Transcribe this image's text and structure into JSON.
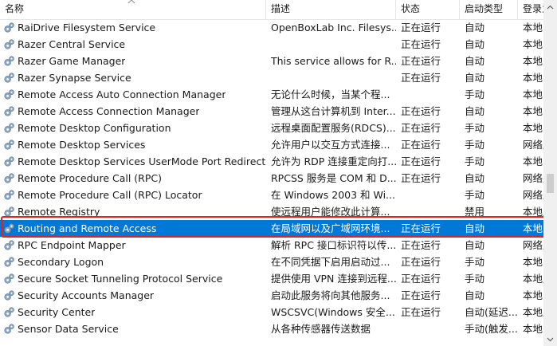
{
  "columns": {
    "name": "名称",
    "desc": "描述",
    "status": "状态",
    "start": "启动类型",
    "logon": "登录为"
  },
  "rows": [
    {
      "name": "RaiDrive Filesystem Service",
      "desc": "OpenBoxLab Inc. Filesys...",
      "status": "正在运行",
      "start": "自动",
      "logon": "本地系统"
    },
    {
      "name": "Razer Central Service",
      "desc": "",
      "status": "正在运行",
      "start": "自动",
      "logon": "本地系统"
    },
    {
      "name": "Razer Game Manager",
      "desc": "This service allows for R...",
      "status": "正在运行",
      "start": "自动",
      "logon": "本地系统"
    },
    {
      "name": "Razer Synapse Service",
      "desc": "",
      "status": "正在运行",
      "start": "自动",
      "logon": "本地系统"
    },
    {
      "name": "Remote Access Auto Connection Manager",
      "desc": "无论什么时候，当某个程...",
      "status": "",
      "start": "手动",
      "logon": "本地系统"
    },
    {
      "name": "Remote Access Connection Manager",
      "desc": "管理从这台计算机到 Inter...",
      "status": "正在运行",
      "start": "自动",
      "logon": "本地系统"
    },
    {
      "name": "Remote Desktop Configuration",
      "desc": "远程桌面配置服务(RDCS)...",
      "status": "正在运行",
      "start": "手动",
      "logon": "本地系统"
    },
    {
      "name": "Remote Desktop Services",
      "desc": "允许用户以交互方式连接...",
      "status": "正在运行",
      "start": "手动",
      "logon": "网络服务"
    },
    {
      "name": "Remote Desktop Services UserMode Port Redirector",
      "desc": "允许为 RDP 连接重定向打...",
      "status": "正在运行",
      "start": "手动",
      "logon": "本地系统"
    },
    {
      "name": "Remote Procedure Call (RPC)",
      "desc": "RPCSS 服务是 COM 和 D...",
      "status": "正在运行",
      "start": "自动",
      "logon": "网络服务"
    },
    {
      "name": "Remote Procedure Call (RPC) Locator",
      "desc": "在 Windows 2003 和 Wi...",
      "status": "",
      "start": "手动",
      "logon": "网络服务"
    },
    {
      "name": "Remote Registry",
      "desc": "使远程用户能修改此计算...",
      "status": "",
      "start": "禁用",
      "logon": "本地服务"
    },
    {
      "name": "Routing and Remote Access",
      "desc": "在局域网以及广域网环境...",
      "status": "正在运行",
      "start": "自动",
      "logon": "本地系统"
    },
    {
      "name": "RPC Endpoint Mapper",
      "desc": "解析 RPC 接口标识符以传...",
      "status": "正在运行",
      "start": "自动",
      "logon": "网络服务"
    },
    {
      "name": "Secondary Logon",
      "desc": "在不同凭据下启用启动过...",
      "status": "正在运行",
      "start": "手动",
      "logon": "本地系统"
    },
    {
      "name": "Secure Socket Tunneling Protocol Service",
      "desc": "提供使用 VPN 连接到远程...",
      "status": "正在运行",
      "start": "手动",
      "logon": "本地服务"
    },
    {
      "name": "Security Accounts Manager",
      "desc": "启动此服务将向其他服务...",
      "status": "正在运行",
      "start": "自动",
      "logon": "本地系统"
    },
    {
      "name": "Security Center",
      "desc": "WSCSVC(Windows 安全...",
      "status": "正在运行",
      "start": "自动(延迟...",
      "logon": "本地服务"
    },
    {
      "name": "Sensor Data Service",
      "desc": "从各种传感器传送数据",
      "status": "",
      "start": "手动(触发...",
      "logon": "本地系统"
    }
  ],
  "selected_index": 12,
  "colors": {
    "selection": "#0078d7",
    "highlight_border": "#e8201c"
  },
  "icons": {
    "row_icon": "service-gear-icon"
  }
}
